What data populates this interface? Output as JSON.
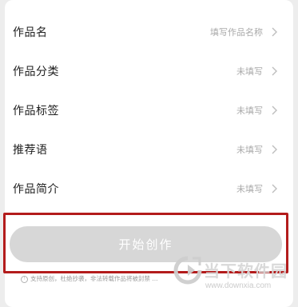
{
  "form": {
    "rows": [
      {
        "label": "作品名",
        "value": "填写作品名称"
      },
      {
        "label": "作品分类",
        "value": "未填写"
      },
      {
        "label": "作品标签",
        "value": "未填写"
      },
      {
        "label": "推荐语",
        "value": "未填写"
      },
      {
        "label": "作品简介",
        "value": "未填写"
      }
    ]
  },
  "start_button_label": "开始创作",
  "notice": "支持原创，杜绝抄袭，非法转载作品将被封禁 ...",
  "watermark": {
    "title": "当下软件园",
    "url": "www.downxia.com"
  },
  "colors": {
    "highlight_border": "#b31c1c",
    "button_disabled": "#d7d7d7",
    "placeholder": "#a9a9a9"
  }
}
